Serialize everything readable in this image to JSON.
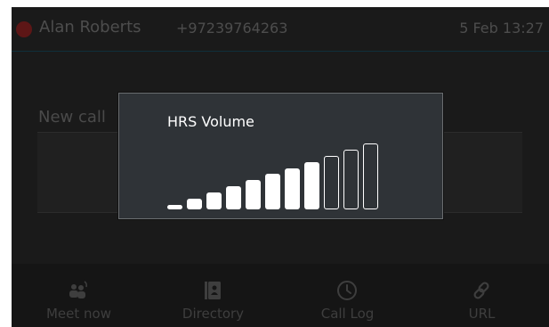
{
  "status_bar": {
    "caller_name": "Alan Roberts",
    "caller_number": "+97239764263",
    "datetime": "5 Feb 13:27"
  },
  "main": {
    "new_call_label": "New call"
  },
  "volume_popup": {
    "title": "HRS Volume",
    "total_levels": 11,
    "current_level": 8
  },
  "softkeys": [
    {
      "label": "Meet now",
      "icon": "meet-now-icon"
    },
    {
      "label": "Directory",
      "icon": "directory-icon"
    },
    {
      "label": "Call Log",
      "icon": "clock-icon"
    },
    {
      "label": "URL",
      "icon": "link-icon"
    }
  ],
  "colors": {
    "call_indicator": "#5d1616",
    "popup_bg": "#2f3337",
    "bar_on": "#ffffff"
  }
}
